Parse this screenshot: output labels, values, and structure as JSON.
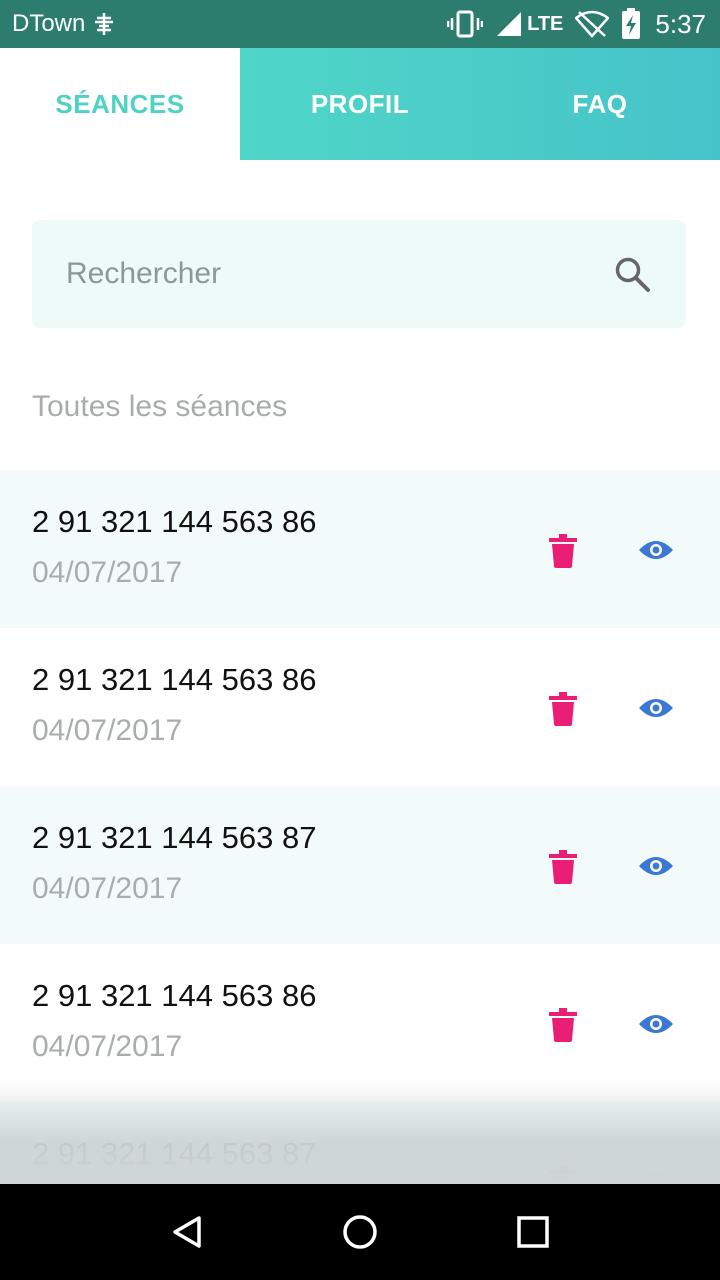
{
  "status_bar": {
    "carrier": "DTown",
    "network": "LTE",
    "time": "5:37"
  },
  "tabs": [
    {
      "label": "SÉANCES",
      "active": true
    },
    {
      "label": "PROFIL",
      "active": false
    },
    {
      "label": "FAQ",
      "active": false
    }
  ],
  "search": {
    "placeholder": "Rechercher"
  },
  "section_label": "Toutes les séances",
  "sessions": [
    {
      "number": "2 91 321 144 563 86",
      "date": "04/07/2017"
    },
    {
      "number": "2 91 321 144 563 86",
      "date": "04/07/2017"
    },
    {
      "number": "2 91 321 144 563 87",
      "date": "04/07/2017"
    },
    {
      "number": "2 91 321 144 563 86",
      "date": "04/07/2017"
    },
    {
      "number": "2 91 321 144 563 87",
      "date": ""
    }
  ],
  "icons": {
    "delete": "trash-icon",
    "view": "eye-icon"
  },
  "colors": {
    "accent": "#4fd1c3",
    "delete": "#e91e74",
    "view": "#3b78d4",
    "status_bar": "#2d7d6f"
  }
}
